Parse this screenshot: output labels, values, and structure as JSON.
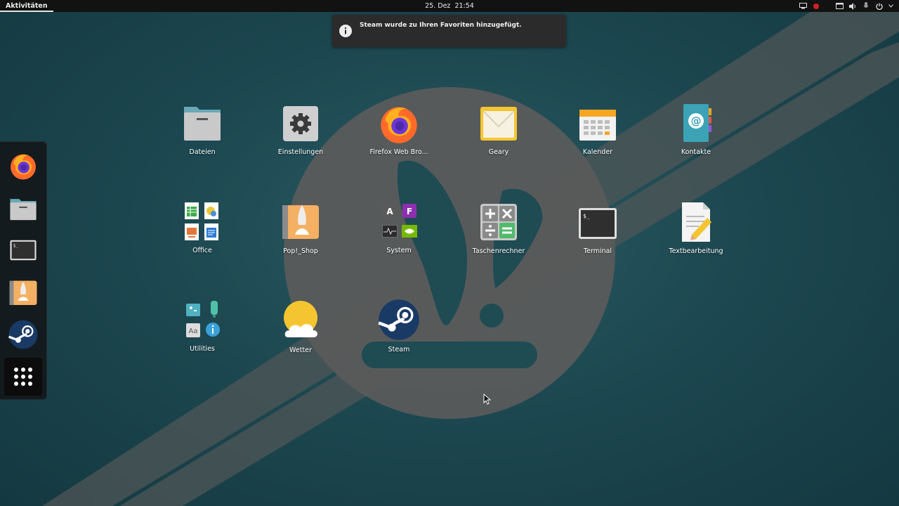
{
  "topbar": {
    "activities": "Aktivitäten",
    "date": "25. Dez",
    "time": "21:54"
  },
  "notification": {
    "message": "Steam wurde zu Ihren Favoriten hinzugefügt.",
    "icon": "info-icon"
  },
  "dock": {
    "items": [
      {
        "name": "Firefox",
        "icon": "firefox-icon"
      },
      {
        "name": "Dateien",
        "icon": "folder-icon"
      },
      {
        "name": "Terminal",
        "icon": "terminal-icon"
      },
      {
        "name": "Pop!_Shop",
        "icon": "popshop-icon"
      },
      {
        "name": "Steam",
        "icon": "steam-icon"
      }
    ],
    "show_apps_icon": "app-grid-icon"
  },
  "apps": [
    {
      "label": "Dateien",
      "icon": "folder-icon"
    },
    {
      "label": "Einstellungen",
      "icon": "gear-icon"
    },
    {
      "label": "Firefox Web Bro...",
      "icon": "firefox-icon"
    },
    {
      "label": "Geary",
      "icon": "mail-icon"
    },
    {
      "label": "Kalender",
      "icon": "calendar-icon"
    },
    {
      "label": "Kontakte",
      "icon": "contacts-icon"
    },
    {
      "label": "Office",
      "icon": "office-folder-icon"
    },
    {
      "label": "Pop!_Shop",
      "icon": "popshop-icon"
    },
    {
      "label": "System",
      "icon": "system-folder-icon"
    },
    {
      "label": "Taschenrechner",
      "icon": "calculator-icon"
    },
    {
      "label": "Terminal",
      "icon": "terminal-icon"
    },
    {
      "label": "Textbearbeitung",
      "icon": "text-editor-icon"
    },
    {
      "label": "Utilities",
      "icon": "utilities-folder-icon"
    },
    {
      "label": "Wetter",
      "icon": "weather-icon"
    },
    {
      "label": "Steam",
      "icon": "steam-icon"
    }
  ],
  "colors": {
    "background": "#1d4851",
    "topbar": "#121212",
    "accent_orange": "#f5a623",
    "logo_gray": "#5e5e5e"
  }
}
